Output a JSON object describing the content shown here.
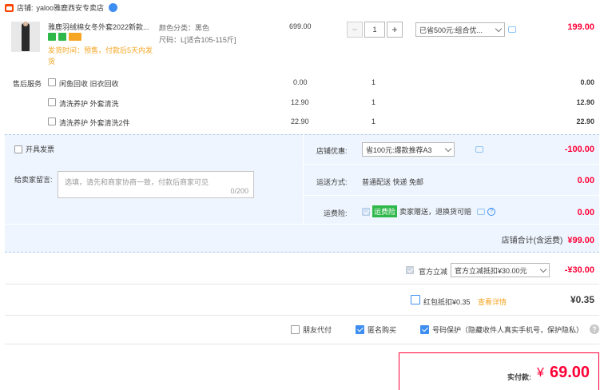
{
  "shop": {
    "label": "店铺:",
    "name": "yaloo雅鹿西安专卖店"
  },
  "item": {
    "title": "雅鹿羽绒棉女冬外套2022新款...",
    "shipping_note": "发货时间：预售，付款后5天内发货",
    "color_label": "颜色分类：",
    "color_value": "黑色",
    "size_label": "尺码：",
    "size_value": "L[适合105-115斤]",
    "unit_price": "699.00",
    "quantity": "1",
    "promo_select": "已省500元:组合优...",
    "subtotal": "199.00"
  },
  "services": {
    "label": "售后服务",
    "rows": [
      {
        "name": "闲鱼回收 旧衣回收",
        "price": "0.00",
        "qty": "1",
        "total": "0.00"
      },
      {
        "name": "清洗养护 外套清洗",
        "price": "12.90",
        "qty": "1",
        "total": "12.90"
      },
      {
        "name": "清洗养护 外套清洗2件",
        "price": "22.90",
        "qty": "1",
        "total": "22.90"
      }
    ]
  },
  "invoice": {
    "label": "开具发票"
  },
  "message": {
    "label": "给卖家留言:",
    "placeholder": "选填，请先和商家协商一致，付款后商家可见",
    "counter": "0/200"
  },
  "shop_discount": {
    "label": "店铺优惠:",
    "select": "省100元:爆款推荐A3",
    "amount": "-100.00"
  },
  "delivery": {
    "label": "运送方式:",
    "method": "普通配送 快递 免邮",
    "amount": "0.00"
  },
  "insurance": {
    "label": "运费险:",
    "badge": "运费险",
    "text": "卖家赠送，退换货可赔",
    "amount": "0.00"
  },
  "shop_total": {
    "label": "店铺合计(含运费)",
    "amount": "¥99.00"
  },
  "platform_discount": {
    "label": "官方立减",
    "select": "官方立减抵扣¥30.00元",
    "amount": "-¥30.00"
  },
  "red_packet": {
    "label": "红包抵扣¥0.35",
    "link": "查看详情",
    "amount": "¥0.35"
  },
  "options": {
    "friend_pay": "朋友代付",
    "anonymous": "匿名购买",
    "privacy": "号码保护（隐藏收件人真实手机号，保护隐私）",
    "help": "?"
  },
  "payable": {
    "label": "实付款:",
    "currency": "¥",
    "amount": "69.00"
  },
  "colors": {
    "accent": "#ff0036",
    "blue_bg": "#eef5fe",
    "checkbox": "#3d8ef0"
  }
}
